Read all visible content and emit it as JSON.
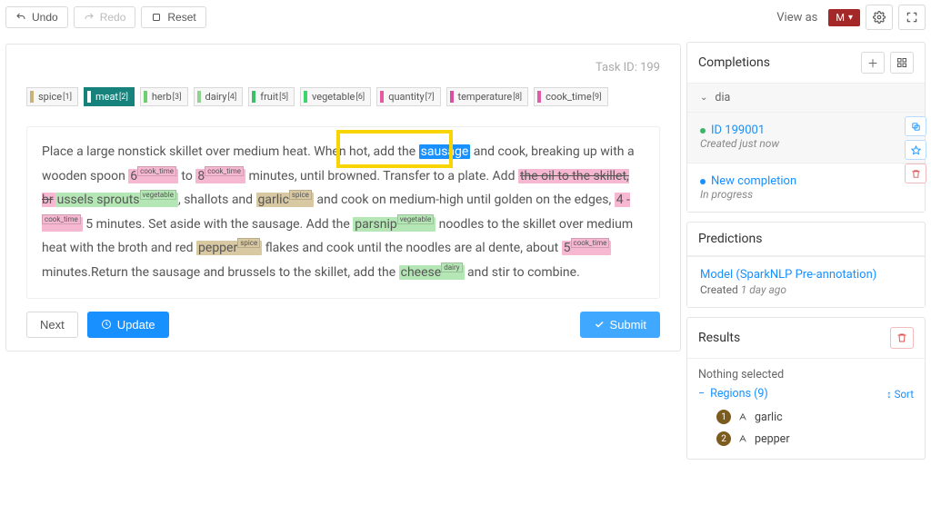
{
  "toolbar": {
    "undo": "Undo",
    "redo": "Redo",
    "reset": "Reset",
    "view_as": "View as",
    "view_badge": "M"
  },
  "task": {
    "id_label": "Task ID: 199",
    "labels": [
      {
        "name": "spice",
        "hotkey": "[1]",
        "color": "#c9b27a"
      },
      {
        "name": "meat",
        "hotkey": "[2]",
        "color": "#138f86",
        "active": true
      },
      {
        "name": "herb",
        "hotkey": "[3]",
        "color": "#6fcf6f"
      },
      {
        "name": "dairy",
        "hotkey": "[4]",
        "color": "#8fd18f"
      },
      {
        "name": "fruit",
        "hotkey": "[5]",
        "color": "#3bbf6b"
      },
      {
        "name": "vegetable",
        "hotkey": "[6]",
        "color": "#3bd46f"
      },
      {
        "name": "quantity",
        "hotkey": "[7]",
        "color": "#e45aa1"
      },
      {
        "name": "temperature",
        "hotkey": "[8]",
        "color": "#d94fa0"
      },
      {
        "name": "cook_time",
        "hotkey": "[9]",
        "color": "#e05aa8"
      }
    ],
    "text": {
      "p1a": "Place a large nonstick skillet over medium heat. When hot, add the ",
      "sausage": "sausage",
      "p1b": " and cook, breaking up with a wooden spoon ",
      "six": "6",
      "six_tag": "cook_time",
      "p1c": " to ",
      "eight": "8",
      "eight_tag": "cook_time",
      "p1d": " minutes, until browned. Transfer to a plate. Add ",
      "struck": "the oil to the skillet, br",
      "brussels": "ussels sprouts",
      "brussels_tag": "vegetable",
      "p1e": ", shallots and ",
      "garlic": "garlic",
      "garlic_tag": "spice",
      "p1f": " and cook on medium-high until golden on the edges, ",
      "four": "4 -",
      "four_tag": "cook_time",
      "p1g": " 5 minutes. Set aside with the sausage. Add the ",
      "parsnip": "parsnip",
      "parsnip_tag": "vegetable",
      "p1h": " noodles to the skillet over medium heat with the broth and red ",
      "pepper": "pepper",
      "pepper_tag": "spice",
      "p1i": " flakes and cook until the noodles are al dente, about ",
      "five": "5",
      "five_tag": "cook_time",
      "p1j": " minutes.Return the sausage and brussels to the skillet, add the ",
      "cheese": "cheese",
      "cheese_tag": "dairy",
      "p1k": " and stir to combine."
    },
    "buttons": {
      "next": "Next",
      "update": "Update",
      "submit": "Submit"
    }
  },
  "completions": {
    "title": "Completions",
    "dia": "dia",
    "id_link": "ID 199001",
    "created": "Created just now",
    "new_completion": "New completion",
    "in_progress": "In progress"
  },
  "predictions": {
    "title": "Predictions",
    "model_link": "Model (SparkNLP Pre-annotation)",
    "created_label": "Created",
    "created_when": "1 day ago"
  },
  "results": {
    "title": "Results",
    "nothing": "Nothing selected",
    "regions_label": "Regions (9)",
    "sort": "Sort",
    "items": [
      {
        "n": "1",
        "text": "garlic"
      },
      {
        "n": "2",
        "text": "pepper"
      }
    ]
  }
}
